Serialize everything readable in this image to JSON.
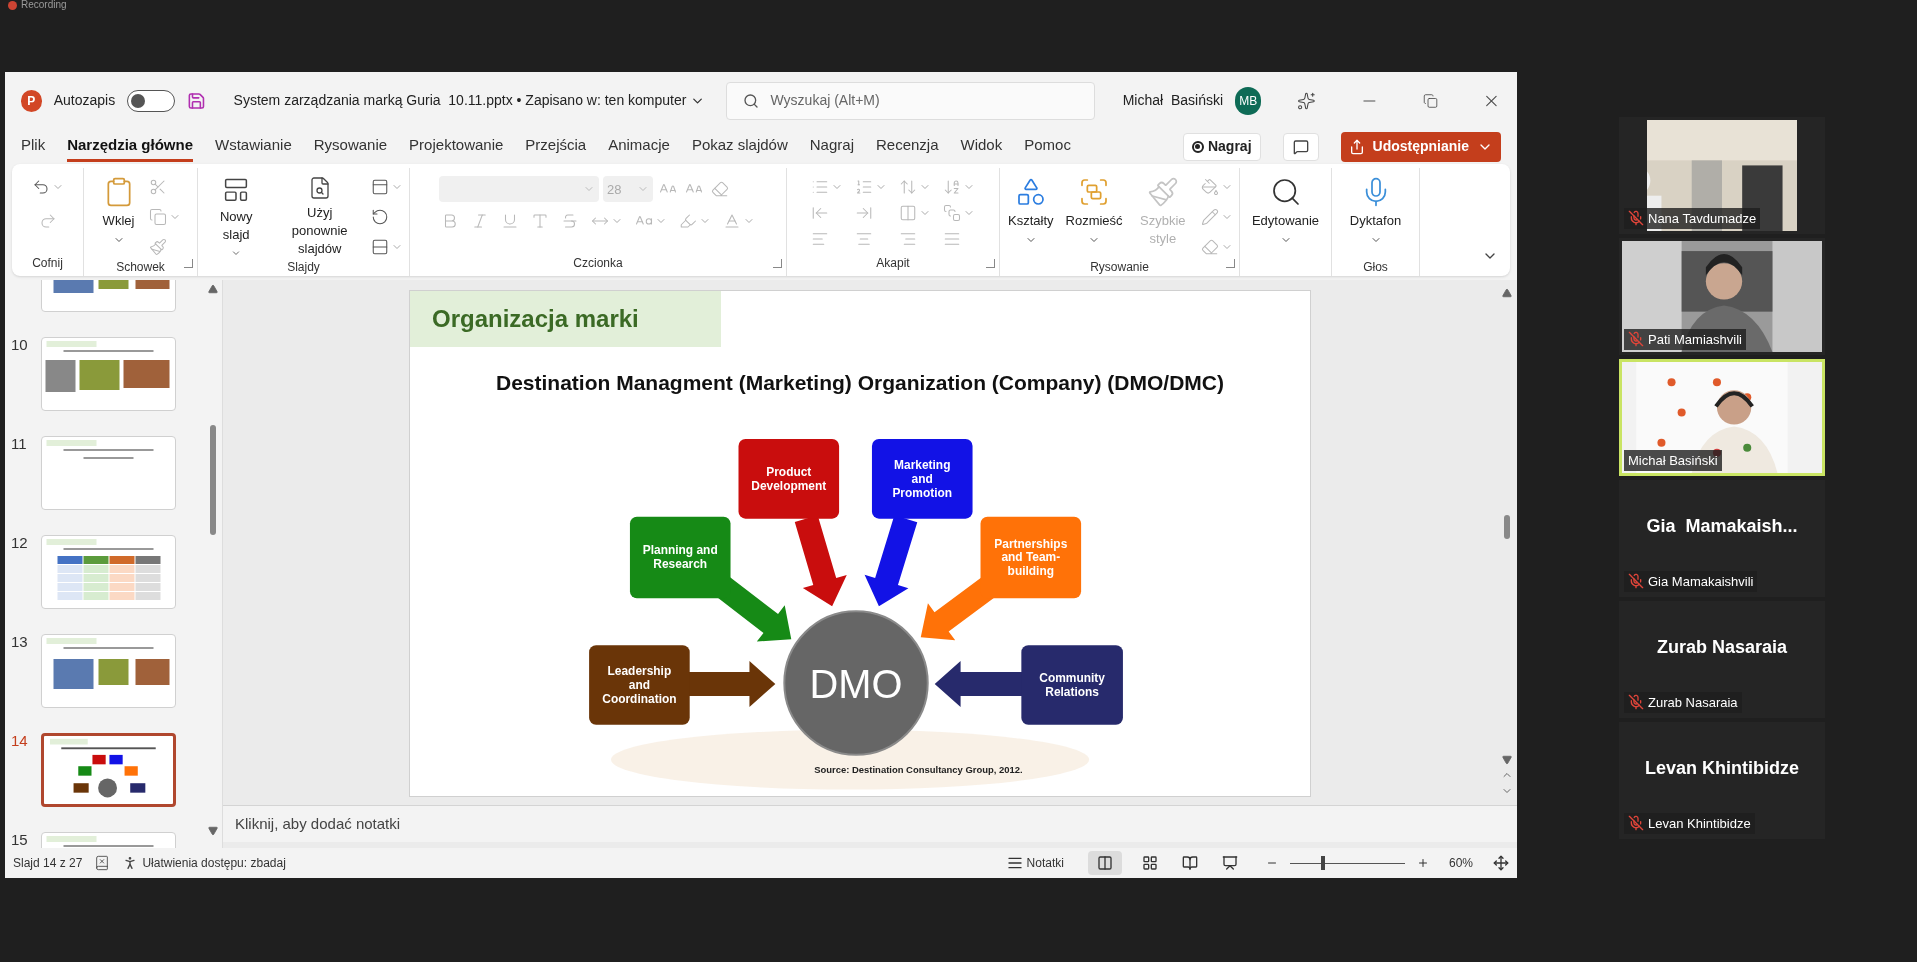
{
  "recording": {
    "label": "Recording"
  },
  "window": {
    "app_badge": "P",
    "autosave_label": "Autozapis",
    "autosave_on": false,
    "title": "System zarządzania marką Guria  10.11.pptx • Zapisano w: ten komputer",
    "search_placeholder": "Wyszukaj (Alt+M)",
    "user_name": "Michał  Basiński",
    "user_initials": "MB"
  },
  "tabs": [
    {
      "label": "Plik",
      "selected": false
    },
    {
      "label": "Narzędzia główne",
      "selected": true
    },
    {
      "label": "Wstawianie",
      "selected": false
    },
    {
      "label": "Rysowanie",
      "selected": false
    },
    {
      "label": "Projektowanie",
      "selected": false
    },
    {
      "label": "Przejścia",
      "selected": false
    },
    {
      "label": "Animacje",
      "selected": false
    },
    {
      "label": "Pokaz slajdów",
      "selected": false
    },
    {
      "label": "Nagraj",
      "selected": false
    },
    {
      "label": "Recenzja",
      "selected": false
    },
    {
      "label": "Widok",
      "selected": false
    },
    {
      "label": "Pomoc",
      "selected": false
    }
  ],
  "tab_actions": {
    "record": "Nagraj",
    "share": "Udostępnianie"
  },
  "ribbon": {
    "groups": [
      {
        "kind": "undo",
        "label": "Cofnij"
      },
      {
        "kind": "clipboard",
        "label": "Schowek",
        "buttons": [
          {
            "label": "Wklej"
          }
        ]
      },
      {
        "kind": "slides",
        "label": "Slajdy",
        "buttons": [
          {
            "label": "Nowy slajd"
          },
          {
            "label": "Użyj ponownie slajdów"
          }
        ]
      },
      {
        "kind": "font",
        "label": "Czcionka",
        "font_size": "28"
      },
      {
        "kind": "paragraph",
        "label": "Akapit"
      },
      {
        "kind": "drawing",
        "label": "Rysowanie",
        "buttons": [
          {
            "label": "Kształty",
            "disabled": false
          },
          {
            "label": "Rozmieść",
            "disabled": false
          },
          {
            "label": "Szybkie style",
            "disabled": true
          }
        ]
      },
      {
        "kind": "editing",
        "buttons": [
          {
            "label": "Edytowanie"
          }
        ]
      },
      {
        "kind": "voice",
        "label": "Głos",
        "buttons": [
          {
            "label": "Dyktafon"
          }
        ]
      }
    ]
  },
  "slides": [
    {
      "selected": false
    },
    {
      "number": "10",
      "selected": false
    },
    {
      "number": "11",
      "selected": false
    },
    {
      "number": "12",
      "selected": false
    },
    {
      "number": "13",
      "selected": false
    },
    {
      "number": "14",
      "selected": true
    },
    {
      "number": "15",
      "selected": false
    }
  ],
  "slide": {
    "title": "Organizacja marki",
    "heading": "Destination Managment (Marketing) Organization (Company) (DMO/DMC)",
    "center": "DMO",
    "nodes": [
      {
        "lines": [
          "Product",
          "Development"
        ],
        "color": "#c90d0d"
      },
      {
        "lines": [
          "Marketing",
          "and",
          "Promotion"
        ],
        "color": "#1212e6"
      },
      {
        "lines": [
          "Planning and",
          "Research"
        ],
        "color": "#168a16"
      },
      {
        "lines": [
          "Partnerships",
          "and Team-",
          "building"
        ],
        "color": "#ff7208"
      },
      {
        "lines": [
          "Leadership",
          "and",
          "Coordination"
        ],
        "color": "#6a3508"
      },
      {
        "lines": [
          "Community",
          "Relations"
        ],
        "color": "#272a6c"
      }
    ],
    "source": "Source: Destination Consultancy Group, 2012."
  },
  "notes": {
    "placeholder": "Kliknij, aby dodać notatki"
  },
  "status_bar": {
    "slide_info": "Slajd 14 z 27",
    "accessibility": "Ułatwienia dostępu: zbadaj",
    "notes": "Notatki",
    "zoom": {
      "level": 0.27,
      "reading": "60%"
    }
  },
  "participants": [
    {
      "kind": "video",
      "name": "Nana Tavdumadze",
      "muted": true,
      "selected": false
    },
    {
      "kind": "video",
      "name": "Pati Mamiashvili",
      "muted": true,
      "selected": false
    },
    {
      "kind": "video",
      "name": "Michał Basiński",
      "muted": false,
      "selected": true
    },
    {
      "kind": "avatar",
      "heading": "Gia  Mamakaish...",
      "name": "Gia Mamakaishvili",
      "muted": true,
      "selected": false
    },
    {
      "kind": "avatar",
      "heading": "Zurab Nasaraia",
      "name": "Zurab Nasaraia",
      "muted": true,
      "selected": false
    },
    {
      "kind": "avatar",
      "heading": "Levan Khintibidze",
      "name": "Levan Khintibidze",
      "muted": true,
      "selected": false
    }
  ]
}
